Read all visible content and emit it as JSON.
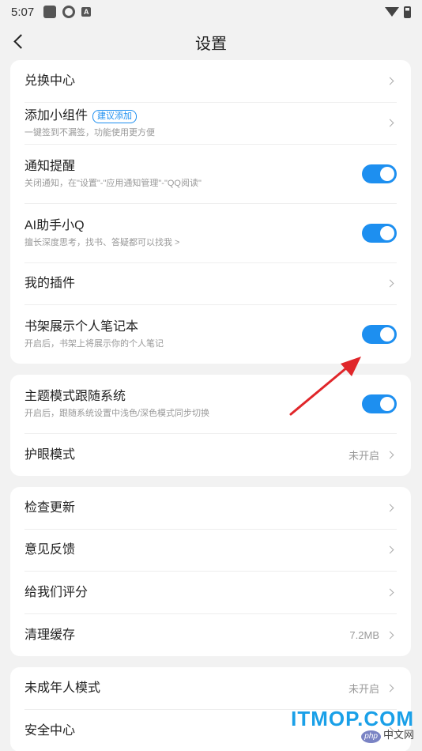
{
  "status_bar": {
    "time": "5:07",
    "app_icon_label": "A"
  },
  "header": {
    "title": "设置"
  },
  "sections": [
    {
      "items": [
        {
          "title": "兑换中心",
          "type": "arrow"
        },
        {
          "title": "添加小组件",
          "badge": "建议添加",
          "subtitle": "一键签到不漏签，功能使用更方便",
          "type": "arrow"
        },
        {
          "title": "通知提醒",
          "subtitle": "关闭通知，在\"设置\"-\"应用通知管理\"-\"QQ阅读\"",
          "type": "toggle",
          "on": true
        },
        {
          "title": "AI助手小Q",
          "subtitle": "擅长深度思考，找书、答疑都可以找我 >",
          "type": "toggle",
          "on": true
        },
        {
          "title": "我的插件",
          "type": "arrow"
        },
        {
          "title": "书架展示个人笔记本",
          "subtitle": "开启后，书架上将展示你的个人笔记",
          "type": "toggle",
          "on": true
        }
      ]
    },
    {
      "items": [
        {
          "title": "主题模式跟随系统",
          "subtitle": "开启后，跟随系统设置中浅色/深色模式同步切换",
          "type": "toggle",
          "on": true
        },
        {
          "title": "护眼模式",
          "value": "未开启",
          "type": "arrow"
        }
      ]
    },
    {
      "items": [
        {
          "title": "检查更新",
          "type": "arrow"
        },
        {
          "title": "意见反馈",
          "type": "arrow"
        },
        {
          "title": "给我们评分",
          "type": "arrow"
        },
        {
          "title": "清理缓存",
          "value": "7.2MB",
          "type": "arrow"
        }
      ]
    },
    {
      "items": [
        {
          "title": "未成年人模式",
          "value": "未开启",
          "type": "arrow"
        },
        {
          "title": "安全中心",
          "type": "arrow"
        }
      ]
    }
  ],
  "watermark": {
    "main": "ITMOP.COM",
    "php": "php",
    "sub": "中文网"
  },
  "colors": {
    "accent": "#1d8ff0",
    "annotation_arrow": "#e0262a"
  }
}
